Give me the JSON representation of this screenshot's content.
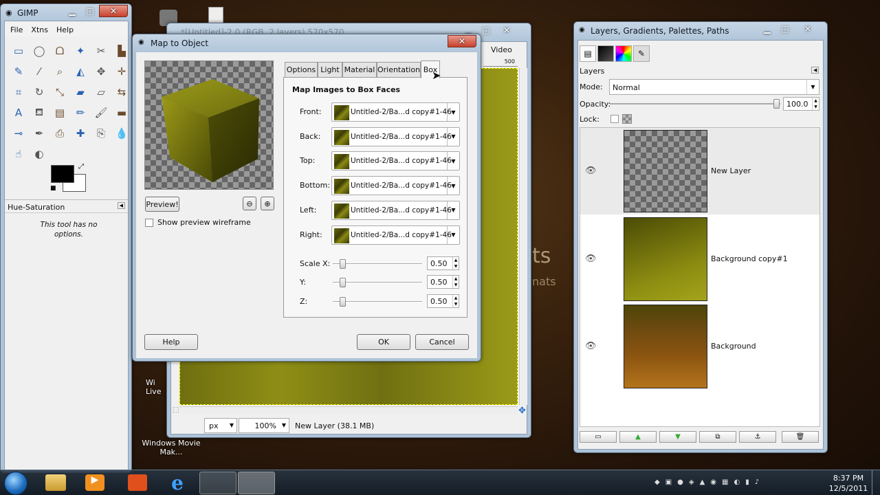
{
  "desktop": {
    "icons": [
      {
        "label": "Wi Live"
      },
      {
        "label": "Windows Movie Mak..."
      }
    ],
    "bg_text": "ts",
    "bg_text2": "nats"
  },
  "toolbox": {
    "title": "GIMP",
    "menu": [
      "File",
      "Xtns",
      "Help"
    ],
    "panel_title": "Hue-Saturation",
    "panel_text": "This tool has no options.",
    "tools": [
      "rect-select-icon",
      "ellipse-select-icon",
      "lasso-icon",
      "fuzzy-select-icon",
      "scissors-icon",
      "fg-select-icon",
      "paths-icon",
      "color-picker-icon",
      "zoom-icon",
      "measure-icon",
      "move-icon",
      "align-icon",
      "crop-icon",
      "rotate-icon",
      "scale-icon",
      "shear-icon",
      "perspective-icon",
      "flip-icon",
      "text-icon",
      "bucket-fill-icon",
      "blend-icon",
      "pencil-icon",
      "paintbrush-icon",
      "eraser-icon",
      "airbrush-icon",
      "ink-icon",
      "clone-icon",
      "heal-icon",
      "perspective-clone-icon",
      "blur-icon",
      "smudge-icon",
      "dodge-icon"
    ]
  },
  "image_window": {
    "title": "*[Untitled]-2.0 (RGB, 2 layers) 570x570",
    "menu_tail": "Video",
    "ruler_value": "500",
    "unit": "px",
    "zoom": "100%",
    "status": "New Layer (38.1 MB)"
  },
  "dialog": {
    "title": "Map to Object",
    "preview_button": "Preview!",
    "wireframe_label": "Show preview wireframe",
    "tabs": [
      "Options",
      "Light",
      "Material",
      "Orientation",
      "Box"
    ],
    "active_tab": "Box",
    "section_title": "Map Images to Box Faces",
    "faces": [
      {
        "label": "Front:",
        "image": "Untitled-2/Ba...d copy#1-46"
      },
      {
        "label": "Back:",
        "image": "Untitled-2/Ba...d copy#1-46"
      },
      {
        "label": "Top:",
        "image": "Untitled-2/Ba...d copy#1-46"
      },
      {
        "label": "Bottom:",
        "image": "Untitled-2/Ba...d copy#1-46"
      },
      {
        "label": "Left:",
        "image": "Untitled-2/Ba...d copy#1-46"
      },
      {
        "label": "Right:",
        "image": "Untitled-2/Ba...d copy#1-46"
      }
    ],
    "scales": [
      {
        "label": "Scale X:",
        "value": "0.50"
      },
      {
        "label": "Y:",
        "value": "0.50"
      },
      {
        "label": "Z:",
        "value": "0.50"
      }
    ],
    "help": "Help",
    "ok": "OK",
    "cancel": "Cancel"
  },
  "layers_window": {
    "title": "Layers, Gradients, Palettes, Paths",
    "panel_title": "Layers",
    "mode_label": "Mode:",
    "mode_value": "Normal",
    "opacity_label": "Opacity:",
    "opacity_value": "100.0",
    "lock_label": "Lock:",
    "layers": [
      {
        "name": "New Layer"
      },
      {
        "name": "Background copy#1"
      },
      {
        "name": "Background"
      }
    ]
  },
  "taskbar": {
    "time": "8:37 PM",
    "date": "12/5/2011"
  }
}
